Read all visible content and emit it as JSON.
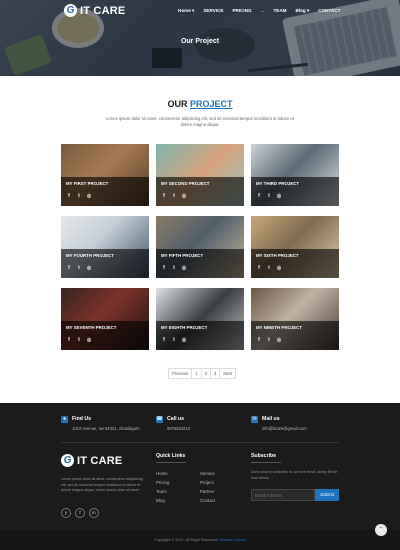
{
  "header": {
    "logo_text": "IT CARE",
    "nav": [
      "Home ▾",
      "SERVICE",
      "PRICING",
      "...",
      "TEAM",
      "Blog ▾",
      "CONTACT"
    ],
    "page_title": "Our Project"
  },
  "projects_section": {
    "title_prefix": "OUR",
    "title_highlight": "PROJECT",
    "description": "Lorem ipsum dolor sit amet, consectetur adipiscing elit, sed do eiusmod tempor incididunt ut labore et dolore magna aliqua.",
    "projects": [
      {
        "title": "MY FIRST PROJECT"
      },
      {
        "title": "MY SECOND PROJECT"
      },
      {
        "title": "MY THIRD PROJECT"
      },
      {
        "title": "MY FOURTH PROJECT"
      },
      {
        "title": "MY FIFTH PROJECT"
      },
      {
        "title": "MY SIXTH PROJECT"
      },
      {
        "title": "MY SEVENTH PROJECT"
      },
      {
        "title": "MY EIGHTH PROJECT"
      },
      {
        "title": "MY NINETH PROJECT"
      }
    ],
    "social_icons": [
      "f",
      "t",
      "◎"
    ]
  },
  "pagination": {
    "prev": "Previous",
    "pages": [
      "1",
      "2",
      "3"
    ],
    "next": "Next"
  },
  "footer": {
    "find_title": "Find Us",
    "find_text": "1010 Avenue, sw 54321, chandigarh",
    "call_title": "Call us",
    "call_text": "9876543210",
    "mail_title": "Mail us",
    "mail_text": "info@itcare@gmail.com",
    "logo_text": "IT CARE",
    "about": "Lorem ipsum dolor sit amet, consectetur adipisicing elit, sed do eiusmod tempor incididunt ut labore et dolore magna aliqua. Lorem ipsum dolor sit amet",
    "quick_links_title": "Quick Links",
    "links_col1": [
      "Home",
      "Pricing",
      "Team",
      "Blog"
    ],
    "links_col2": [
      "Service",
      "Project",
      "Partner",
      "Contact"
    ],
    "subscribe_title": "Subscribe",
    "subscribe_text": "Don't miss to subscribe to our new feeds, kindly fill the form below.",
    "email_placeholder": "Email Address",
    "subscribe_button": "Submit",
    "copyright": "Copyright © 2021, All Right Reserved",
    "copyright_link": "Chandan Kumar",
    "social": [
      "y",
      "f",
      "in"
    ]
  },
  "colors": {
    "accent": "#1e73be",
    "footer_bg": "#1b1b1b"
  }
}
